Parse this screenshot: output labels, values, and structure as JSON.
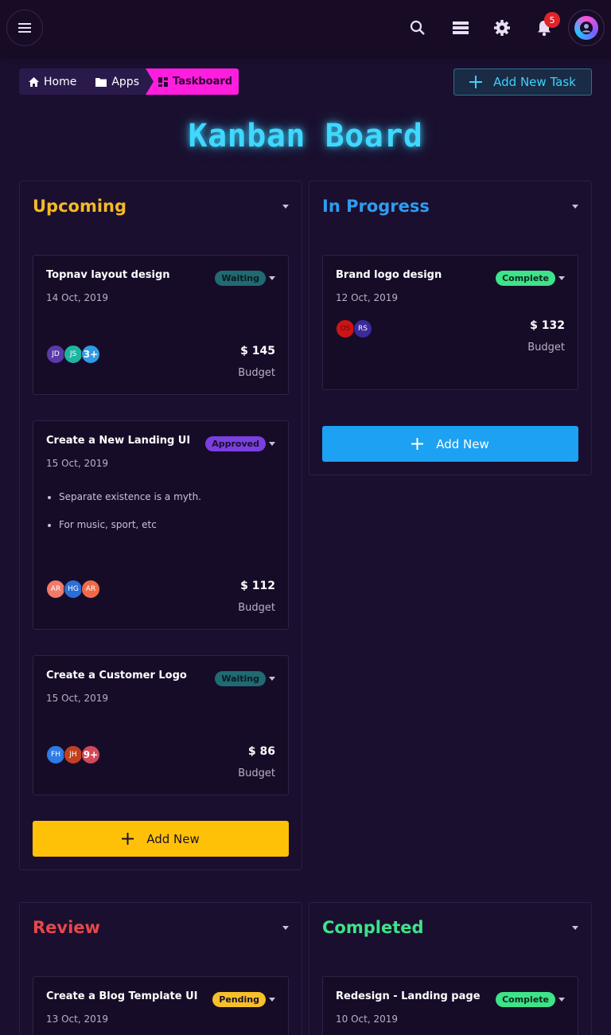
{
  "topbar": {
    "menu_icon": "hamburger-icon",
    "search_icon": "search-icon",
    "layers_icon": "layers-icon",
    "settings_icon": "gear-icon",
    "bell_icon": "bell-icon",
    "notification_count": "5"
  },
  "breadcrumb": {
    "home": "Home",
    "apps": "Apps",
    "current": "Taskboard"
  },
  "add_task_label": "Add New Task",
  "page_title": "Kanban Board",
  "colors": {
    "upcoming": "#f6b925",
    "in_progress": "#2f9cf0",
    "review": "#e5484d",
    "completed": "#3ee38a",
    "waiting_badge": "#1f6a73",
    "approved_badge": "#7b3fe0",
    "complete_badge": "#3ee38a",
    "pending_badge": "#f6c02a",
    "add_yellow": "#ffc107",
    "add_blue": "#1da1f2"
  },
  "columns": {
    "upcoming": {
      "title": "Upcoming",
      "add_label": "Add New",
      "cards": [
        {
          "title": "Topnav layout design",
          "date": "14 Oct, 2019",
          "status": "Waiting",
          "avatars": [
            "JD",
            "JS",
            "3+"
          ],
          "budget": "$ 145",
          "budget_label": "Budget"
        },
        {
          "title": "Create a New Landing UI",
          "date": "15 Oct, 2019",
          "status": "Approved",
          "bullets": [
            "Separate existence is a myth.",
            "For music, sport, etc"
          ],
          "avatars": [
            "AR",
            "HG",
            "AR"
          ],
          "budget": "$ 112",
          "budget_label": "Budget"
        },
        {
          "title": "Create a Customer Logo",
          "date": "15 Oct, 2019",
          "status": "Waiting",
          "avatars": [
            "FH",
            "JH",
            "9+"
          ],
          "budget": "$ 86",
          "budget_label": "Budget"
        }
      ]
    },
    "in_progress": {
      "title": "In Progress",
      "add_label": "Add New",
      "cards": [
        {
          "title": "Brand logo design",
          "date": "12 Oct, 2019",
          "status": "Complete",
          "avatars": [
            "OS",
            "RS"
          ],
          "budget": "$ 132",
          "budget_label": "Budget"
        }
      ]
    },
    "review": {
      "title": "Review",
      "cards": [
        {
          "title": "Create a Blog Template UI",
          "date": "13 Oct, 2019",
          "status": "Pending"
        }
      ]
    },
    "completed": {
      "title": "Completed",
      "cards": [
        {
          "title": "Redesign - Landing page",
          "date": "10 Oct, 2019",
          "status": "Complete"
        }
      ]
    }
  }
}
